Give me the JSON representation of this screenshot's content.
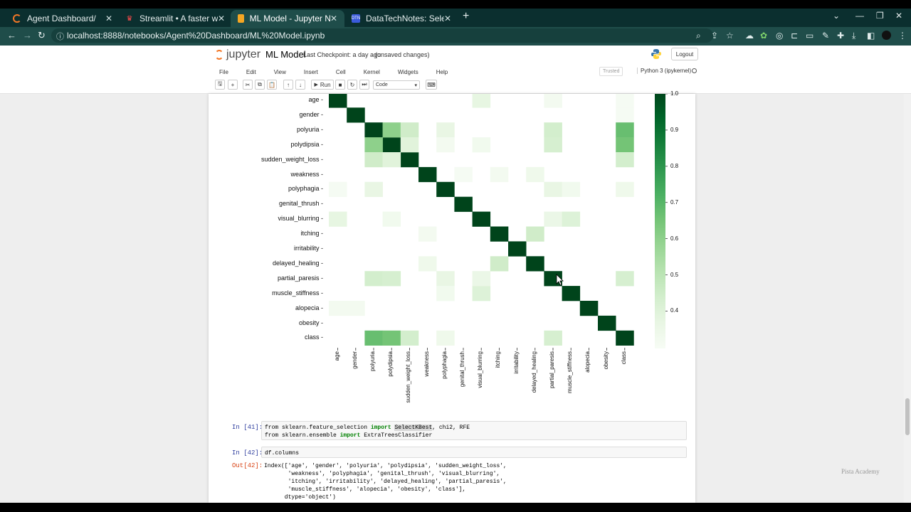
{
  "browser": {
    "tabs": [
      {
        "label": "Agent Dashboard/",
        "icon": "jupyter-spinner-icon"
      },
      {
        "label": "Streamlit • A faster way to build",
        "icon": "streamlit-crown-icon"
      },
      {
        "label": "ML Model - Jupyter Notebook",
        "icon": "notebook-icon"
      },
      {
        "label": "DataTechNotes: SelectKBest Fea",
        "icon": "dtn-icon"
      }
    ],
    "url": "localhost:8888/notebooks/Agent%20Dashboard/ML%20Model.ipynb",
    "theme_color": "#1f4d4a"
  },
  "jupyter": {
    "logo_text": "jupyter",
    "notebook_title": "ML Model",
    "checkpoint": "Last Checkpoint: a day ago",
    "unsaved": "(unsaved changes)",
    "logout": "Logout",
    "menu": [
      "File",
      "Edit",
      "View",
      "Insert",
      "Cell",
      "Kernel",
      "Widgets",
      "Help"
    ],
    "trusted": "Trusted",
    "kernel": "Python 3 (ipykernel)",
    "run_label": "Run",
    "cell_type": "Code"
  },
  "chart_data": {
    "type": "heatmap",
    "features": [
      "age",
      "gender",
      "polyuria",
      "polydipsia",
      "sudden_weight_loss",
      "weakness",
      "polyphagia",
      "genital_thrush",
      "visual_blurring",
      "itching",
      "irritability",
      "delayed_healing",
      "partial_paresis",
      "muscle_stiffness",
      "alopecia",
      "obesity",
      "class"
    ],
    "colormap": "Greens",
    "colorbar_ticks": [
      "1.0",
      "0.9",
      "0.8",
      "0.7",
      "0.6",
      "0.5",
      "0.4"
    ],
    "colorbar_range": [
      0.3,
      1.0
    ],
    "off_diagonal": [
      {
        "r": "age",
        "c": "visual_blurring",
        "v": 0.38
      },
      {
        "r": "age",
        "c": "partial_paresis",
        "v": 0.32
      },
      {
        "r": "age",
        "c": "class",
        "v": 0.31
      },
      {
        "r": "gender",
        "c": "class",
        "v": 0.31
      },
      {
        "r": "polyuria",
        "c": "polydipsia",
        "v": 0.6
      },
      {
        "r": "polyuria",
        "c": "sudden_weight_loss",
        "v": 0.45
      },
      {
        "r": "polyuria",
        "c": "polyphagia",
        "v": 0.37
      },
      {
        "r": "polyuria",
        "c": "partial_paresis",
        "v": 0.44
      },
      {
        "r": "polyuria",
        "c": "class",
        "v": 0.67
      },
      {
        "r": "polydipsia",
        "c": "sudden_weight_loss",
        "v": 0.4
      },
      {
        "r": "polydipsia",
        "c": "partial_paresis",
        "v": 0.43
      },
      {
        "r": "polydipsia",
        "c": "class",
        "v": 0.65
      },
      {
        "r": "polydipsia",
        "c": "visual_blurring",
        "v": 0.33
      },
      {
        "r": "polydipsia",
        "c": "polyphagia",
        "v": 0.32
      },
      {
        "r": "sudden_weight_loss",
        "c": "class",
        "v": 0.44
      },
      {
        "r": "weakness",
        "c": "delayed_healing",
        "v": 0.34
      },
      {
        "r": "weakness",
        "c": "itching",
        "v": 0.32
      },
      {
        "r": "weakness",
        "c": "genital_thrush",
        "v": 0.31
      },
      {
        "r": "polyphagia",
        "c": "partial_paresis",
        "v": 0.37
      },
      {
        "r": "polyphagia",
        "c": "muscle_stiffness",
        "v": 0.33
      },
      {
        "r": "polyphagia",
        "c": "class",
        "v": 0.34
      },
      {
        "r": "visual_blurring",
        "c": "partial_paresis",
        "v": 0.36
      },
      {
        "r": "visual_blurring",
        "c": "muscle_stiffness",
        "v": 0.41
      },
      {
        "r": "itching",
        "c": "delayed_healing",
        "v": 0.45
      },
      {
        "r": "partial_paresis",
        "c": "class",
        "v": 0.43
      },
      {
        "r": "muscle_stiffness",
        "c": "visual_blurring",
        "v": 0.41
      },
      {
        "r": "delayed_healing",
        "c": "itching",
        "v": 0.45
      },
      {
        "r": "class",
        "c": "polyuria",
        "v": 0.67
      },
      {
        "r": "class",
        "c": "polydipsia",
        "v": 0.65
      },
      {
        "r": "class",
        "c": "sudden_weight_loss",
        "v": 0.44
      },
      {
        "r": "class",
        "c": "partial_paresis",
        "v": 0.43
      },
      {
        "r": "class",
        "c": "polyphagia",
        "v": 0.34
      },
      {
        "r": "partial_paresis",
        "c": "polyuria",
        "v": 0.44
      },
      {
        "r": "partial_paresis",
        "c": "polydipsia",
        "v": 0.43
      },
      {
        "r": "partial_paresis",
        "c": "polyphagia",
        "v": 0.37
      },
      {
        "r": "partial_paresis",
        "c": "visual_blurring",
        "v": 0.36
      },
      {
        "r": "polydipsia",
        "c": "polyuria",
        "v": 0.6
      },
      {
        "r": "sudden_weight_loss",
        "c": "polyuria",
        "v": 0.45
      },
      {
        "r": "sudden_weight_loss",
        "c": "polydipsia",
        "v": 0.4
      },
      {
        "r": "polyphagia",
        "c": "polyuria",
        "v": 0.37
      },
      {
        "r": "polyphagia",
        "c": "age",
        "v": 0.31
      },
      {
        "r": "visual_blurring",
        "c": "age",
        "v": 0.38
      },
      {
        "r": "muscle_stiffness",
        "c": "polyphagia",
        "v": 0.33
      },
      {
        "r": "delayed_healing",
        "c": "weakness",
        "v": 0.34
      },
      {
        "r": "itching",
        "c": "weakness",
        "v": 0.32
      },
      {
        "r": "alopecia",
        "c": "age",
        "v": 0.32
      },
      {
        "r": "alopecia",
        "c": "gender",
        "v": 0.32
      },
      {
        "r": "visual_blurring",
        "c": "polydipsia",
        "v": 0.33
      }
    ]
  },
  "cells": {
    "in41_prompt": "In [41]:",
    "in41_line1_a": "from sklearn.feature_selection ",
    "in41_line1_kw": "import",
    "in41_line1_hl": "SelectKBest",
    "in41_line1_b": ", chi2, RFE",
    "in41_line2_a": "from sklearn.ensemble ",
    "in41_line2_kw": "import",
    "in41_line2_b": " ExtraTreesClassifier",
    "in42_prompt": "In [42]:",
    "in42_code": "df.columns",
    "out42_prompt": "Out[42]:",
    "out42_text": "Index(['age', 'gender', 'polyuria', 'polydipsia', 'sudden_weight_loss',\n       'weakness', 'polyphagia', 'genital_thrush', 'visual_blurring',\n       'itching', 'irritability', 'delayed_healing', 'partial_paresis',\n       'muscle_stiffness', 'alopecia', 'obesity', 'class'],\n      dtype='object')"
  },
  "watermark": "Pista Academy"
}
